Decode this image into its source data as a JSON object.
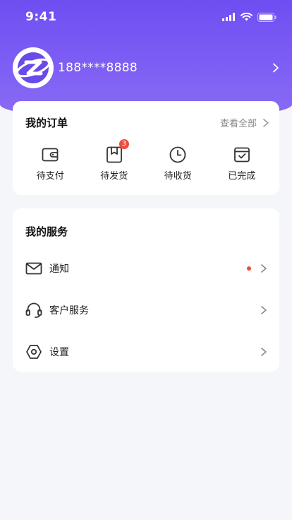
{
  "status_bar": {
    "time": "9:41"
  },
  "profile": {
    "phone": "188****8888"
  },
  "orders": {
    "title": "我的订单",
    "view_all": "查看全部",
    "items": [
      {
        "label": "待支付",
        "icon": "wallet-icon",
        "badge": ""
      },
      {
        "label": "待发货",
        "icon": "package-icon",
        "badge": "3"
      },
      {
        "label": "待收货",
        "icon": "clock-icon",
        "badge": ""
      },
      {
        "label": "已完成",
        "icon": "calendar-check-icon",
        "badge": ""
      }
    ]
  },
  "services": {
    "title": "我的服务",
    "items": [
      {
        "label": "通知",
        "icon": "mail-icon",
        "has_dot": true
      },
      {
        "label": "客户服务",
        "icon": "headset-icon",
        "has_dot": false
      },
      {
        "label": "设置",
        "icon": "settings-icon",
        "has_dot": false
      }
    ]
  },
  "colors": {
    "accent": "#6f4ef2",
    "badge": "#f04a3e"
  }
}
